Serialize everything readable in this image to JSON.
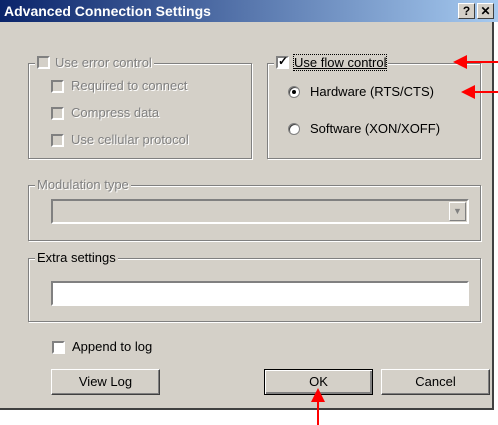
{
  "window": {
    "title": "Advanced Connection Settings",
    "help_label": "?",
    "close_label": "✕"
  },
  "error_control": {
    "label": "Use error control",
    "checked": false,
    "enabled": false,
    "options": [
      {
        "label": "Required to connect",
        "checked": false
      },
      {
        "label": "Compress data",
        "checked": false
      },
      {
        "label": "Use cellular protocol",
        "checked": false
      }
    ]
  },
  "flow_control": {
    "label": "Use flow control",
    "checked": true,
    "options": [
      {
        "label": "Hardware (RTS/CTS)",
        "selected": true
      },
      {
        "label": "Software (XON/XOFF)",
        "selected": false
      }
    ]
  },
  "modulation": {
    "label": "Modulation type",
    "value": "",
    "enabled": false
  },
  "extra_settings": {
    "label": "Extra settings",
    "value": ""
  },
  "log": {
    "append_label": "Append to log",
    "append_checked": false,
    "view_log_label": "View Log"
  },
  "buttons": {
    "ok_label": "OK",
    "cancel_label": "Cancel"
  },
  "annotation_color": "#ff0000"
}
